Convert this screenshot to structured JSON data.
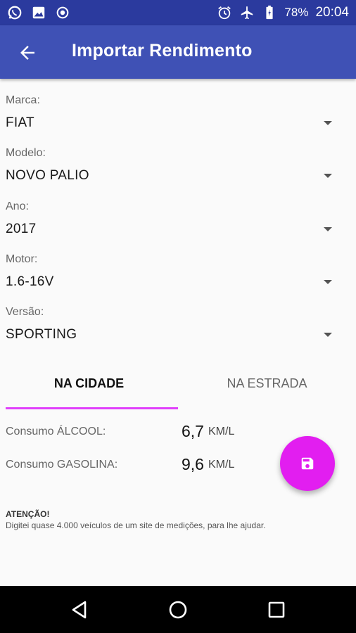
{
  "statusbar": {
    "icons_left": [
      "whatsapp-icon",
      "image-icon",
      "record-icon"
    ],
    "icons_right": [
      "alarm-icon",
      "airplane-icon",
      "battery-icon"
    ],
    "battery": "78%",
    "time": "20:04"
  },
  "appbar": {
    "title": "Importar Rendimento"
  },
  "fields": [
    {
      "label": "Marca:",
      "value": "FIAT"
    },
    {
      "label": "Modelo:",
      "value": "NOVO PALIO"
    },
    {
      "label": "Ano:",
      "value": "2017"
    },
    {
      "label": "Motor:",
      "value": "1.6-16V"
    },
    {
      "label": "Versão:",
      "value": "SPORTING"
    }
  ],
  "tabs": [
    {
      "label": "NA CIDADE",
      "selected": true
    },
    {
      "label": "NA ESTRADA",
      "selected": false
    }
  ],
  "consumo": [
    {
      "label": "Consumo ÁLCOOL:",
      "value": "6,7",
      "unit": "KM/L"
    },
    {
      "label": "Consumo GASOLINA:",
      "value": "9,6",
      "unit": "KM/L"
    }
  ],
  "fab": {
    "icon": "save-icon",
    "color": "#e21ef0"
  },
  "warning": {
    "title": "ATENÇÃO!",
    "text": "Digitei quase 4.000 veículos de um site de medições, para lhe ajudar."
  },
  "colors": {
    "primary": "#3f51b5",
    "primary_dark": "#2b3a9e",
    "accent": "#e040fb"
  },
  "navbar": {
    "buttons": [
      "back-triangle-icon",
      "home-circle-icon",
      "recents-square-icon"
    ]
  }
}
